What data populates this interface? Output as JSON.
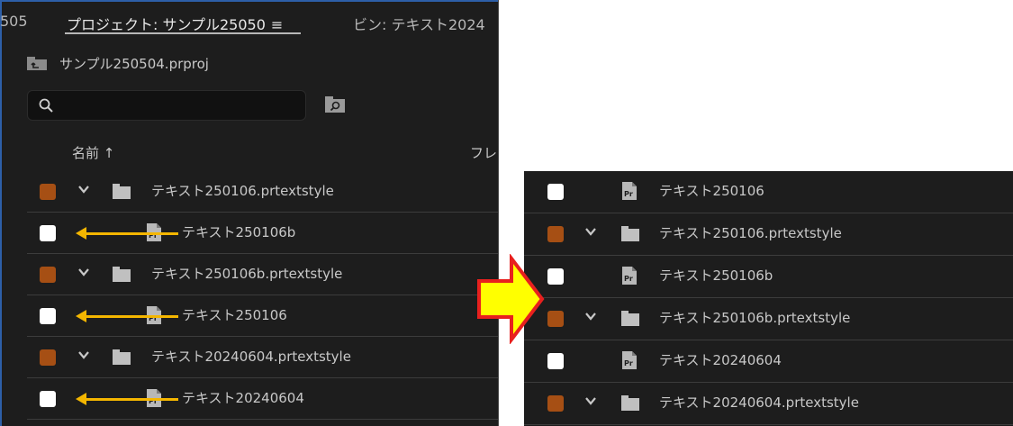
{
  "colors": {
    "panel_bg": "#1d1d1d",
    "folder_swatch": "#a64f14",
    "file_swatch": "#ffffff",
    "annotation_arrow": "#f4b600",
    "big_arrow_fill": "#ffff00",
    "big_arrow_stroke": "#e8201e"
  },
  "left_panel": {
    "tabs": [
      {
        "label": "505",
        "icon": null
      },
      {
        "label": "プロジェクト: サンプル25050",
        "icon": "hamburger-menu-icon"
      },
      {
        "label": "ビン: テキスト2024",
        "icon": null
      }
    ],
    "menu_glyph": "≡",
    "project_file": "サンプル250504.prproj",
    "search": {
      "value": "",
      "placeholder": ""
    },
    "column_headers": {
      "name": "名前 ↑",
      "frame": "フレ"
    },
    "rows": [
      {
        "label": "テキスト250106.prtextstyle",
        "type": "folder",
        "expand": true,
        "swatch": "brown",
        "arrow": false
      },
      {
        "label": "テキスト250106b",
        "type": "file",
        "expand": false,
        "swatch": "white",
        "arrow": true
      },
      {
        "label": "テキスト250106b.prtextstyle",
        "type": "folder",
        "expand": true,
        "swatch": "brown",
        "arrow": false
      },
      {
        "label": "テキスト250106",
        "type": "file",
        "expand": false,
        "swatch": "white",
        "arrow": true
      },
      {
        "label": "テキスト20240604.prtextstyle",
        "type": "folder",
        "expand": true,
        "swatch": "brown",
        "arrow": false
      },
      {
        "label": "テキスト20240604",
        "type": "file",
        "expand": false,
        "swatch": "white",
        "arrow": true
      }
    ]
  },
  "right_panel": {
    "rows": [
      {
        "label": "テキスト250106",
        "type": "file",
        "expand": false,
        "swatch": "white"
      },
      {
        "label": "テキスト250106.prtextstyle",
        "type": "folder",
        "expand": true,
        "swatch": "brown"
      },
      {
        "label": "テキスト250106b",
        "type": "file",
        "expand": false,
        "swatch": "white"
      },
      {
        "label": "テキスト250106b.prtextstyle",
        "type": "folder",
        "expand": true,
        "swatch": "brown"
      },
      {
        "label": "テキスト20240604",
        "type": "file",
        "expand": false,
        "swatch": "white"
      },
      {
        "label": "テキスト20240604.prtextstyle",
        "type": "folder",
        "expand": true,
        "swatch": "brown"
      }
    ]
  }
}
